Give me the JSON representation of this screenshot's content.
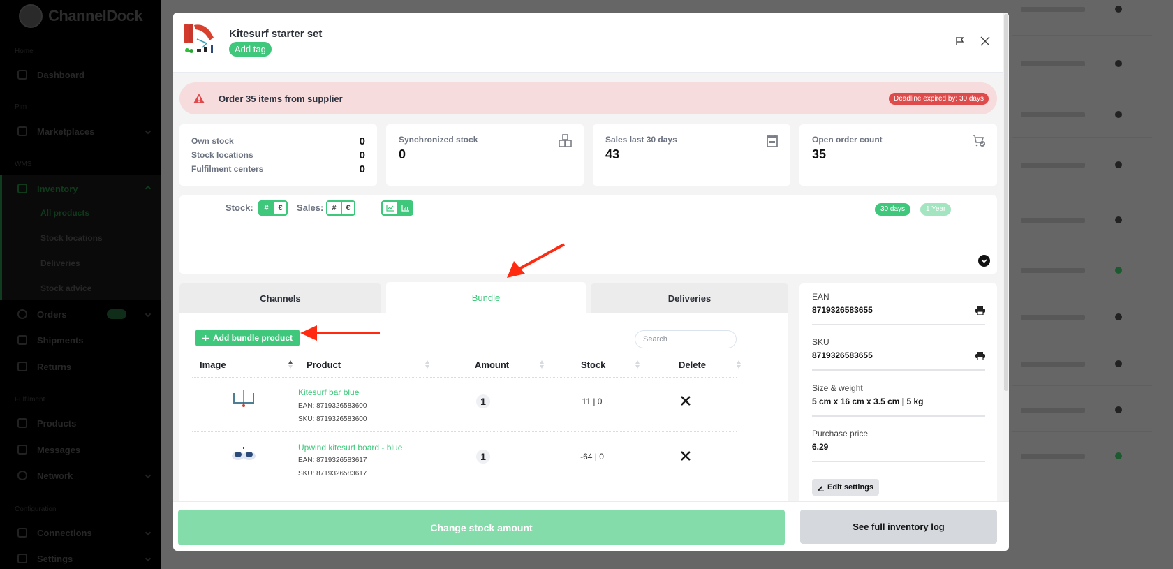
{
  "app": {
    "brand": "ChannelDock"
  },
  "sidebar": {
    "sections": [
      "Home",
      "Pim",
      "WMS",
      "Fulfilment",
      "Configuration"
    ],
    "items": [
      {
        "label": "Dashboard"
      },
      {
        "label": "Marketplaces"
      },
      {
        "label": "Inventory"
      },
      {
        "label": "Orders"
      },
      {
        "label": "Shipments"
      },
      {
        "label": "Returns"
      },
      {
        "label": "Products"
      },
      {
        "label": "Messages"
      },
      {
        "label": "Network"
      },
      {
        "label": "Connections"
      },
      {
        "label": "Settings"
      }
    ],
    "inventory_sub": [
      {
        "label": "All products"
      },
      {
        "label": "Stock locations"
      },
      {
        "label": "Deliveries"
      },
      {
        "label": "Stock advice"
      }
    ]
  },
  "modal": {
    "title": "Kitesurf starter set",
    "add_tag_label": "Add tag",
    "flag_icon": "flag-icon",
    "close_icon": "close-icon",
    "alert": {
      "message": "Order 35 items from supplier",
      "deadline_badge": "Deadline expired by: 30 days",
      "icon": "warning-triangle-icon"
    },
    "stats": {
      "own_stock": {
        "rows": [
          {
            "label": "Own stock",
            "value": "0"
          },
          {
            "label": "Stock locations",
            "value": "0"
          },
          {
            "label": "Fulfilment centers",
            "value": "0"
          }
        ]
      },
      "synchronized": {
        "label": "Synchronized stock",
        "value": "0",
        "icon": "boxes-icon"
      },
      "sales": {
        "label": "Sales last 30 days",
        "value": "43",
        "icon": "calendar-icon"
      },
      "open_orders": {
        "label": "Open order count",
        "value": "35",
        "icon": "cart-check-icon"
      }
    },
    "chart_controls": {
      "stock_label": "Stock:",
      "sales_label": "Sales:",
      "stock_options": [
        "#",
        "€"
      ],
      "stock_selected": "#",
      "sales_options": [
        "#",
        "€"
      ],
      "sales_selected": "none",
      "chart_types": [
        "line-chart-icon",
        "bar-chart-icon"
      ],
      "chart_type_selected": "bar-chart-icon",
      "ranges": [
        "30 days",
        "1 Year"
      ],
      "range_selected": "30 days",
      "accent": "#3fc77c"
    },
    "tabs": [
      {
        "label": "Channels",
        "active": false
      },
      {
        "label": "Bundle",
        "active": true
      },
      {
        "label": "Deliveries",
        "active": false
      }
    ],
    "bundle": {
      "add_button_label": "Add bundle product",
      "search_placeholder": "Search",
      "columns": [
        "Image",
        "Product",
        "Amount",
        "Stock",
        "Delete"
      ],
      "rows": [
        {
          "name": "Kitesurf bar blue",
          "ean": "EAN: 8719326583600",
          "sku": "SKU: 8719326583600",
          "amount": "1",
          "stock": "11 | 0"
        },
        {
          "name": "Upwind kitesurf board - blue",
          "ean": "EAN: 8719326583617",
          "sku": "SKU: 8719326583617",
          "amount": "1",
          "stock": "-64 | 0"
        }
      ]
    },
    "info": {
      "fields": [
        {
          "label": "EAN",
          "value": "8719326583655",
          "printable": true
        },
        {
          "label": "SKU",
          "value": "8719326583655",
          "printable": true
        },
        {
          "label": "Size & weight",
          "value": "5 cm x 16 cm x 3.5 cm | 5 kg",
          "printable": false
        },
        {
          "label": "Purchase price",
          "value": "6.29",
          "printable": false
        }
      ],
      "edit_button_label": "Edit settings"
    },
    "footer": {
      "change_stock_label": "Change stock amount",
      "inventory_log_label": "See full inventory log"
    }
  },
  "colors": {
    "accent_green": "#3fc77c",
    "alert_bg": "#f6dcdc",
    "alert_badge": "#df4a4a",
    "annotation_arrow": "#ff2a10"
  }
}
